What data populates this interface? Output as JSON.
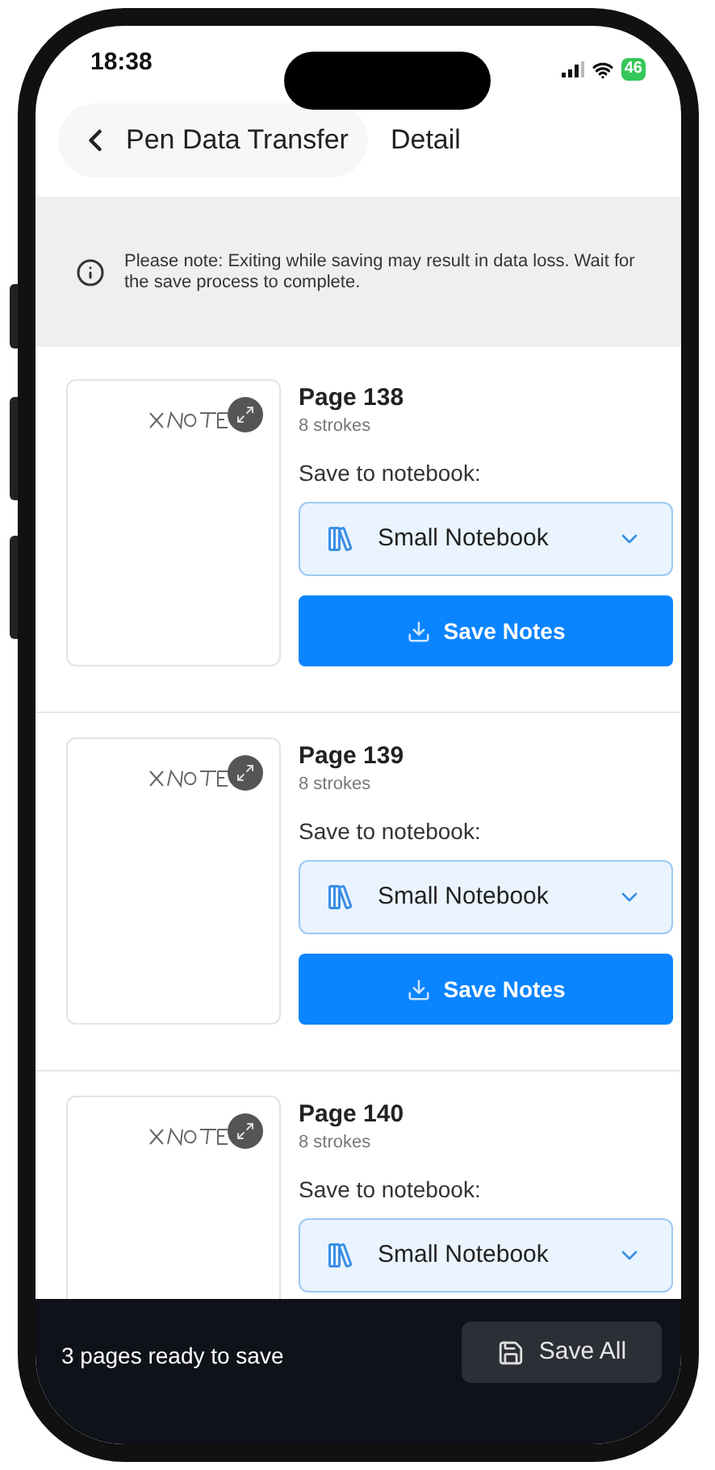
{
  "status_bar": {
    "time": "18:38",
    "battery": "46"
  },
  "header": {
    "back_label": "Pen Data Transfer",
    "title": "Detail"
  },
  "notice": "Please note: Exiting while saving may result in data loss. Wait for the save process to complete.",
  "pages": [
    {
      "title": "Page 138",
      "strokes": "8 strokes",
      "notebook_label": "Save to notebook:",
      "notebook": "Small Notebook",
      "save_button": "Save Notes"
    },
    {
      "title": "Page 139",
      "strokes": "8 strokes",
      "notebook_label": "Save to notebook:",
      "notebook": "Small Notebook",
      "save_button": "Save Notes"
    },
    {
      "title": "Page 140",
      "strokes": "8 strokes",
      "notebook_label": "Save to notebook:",
      "notebook": "Small Notebook"
    }
  ],
  "footer": {
    "summary": "3 pages ready to save",
    "button": "Save All"
  }
}
